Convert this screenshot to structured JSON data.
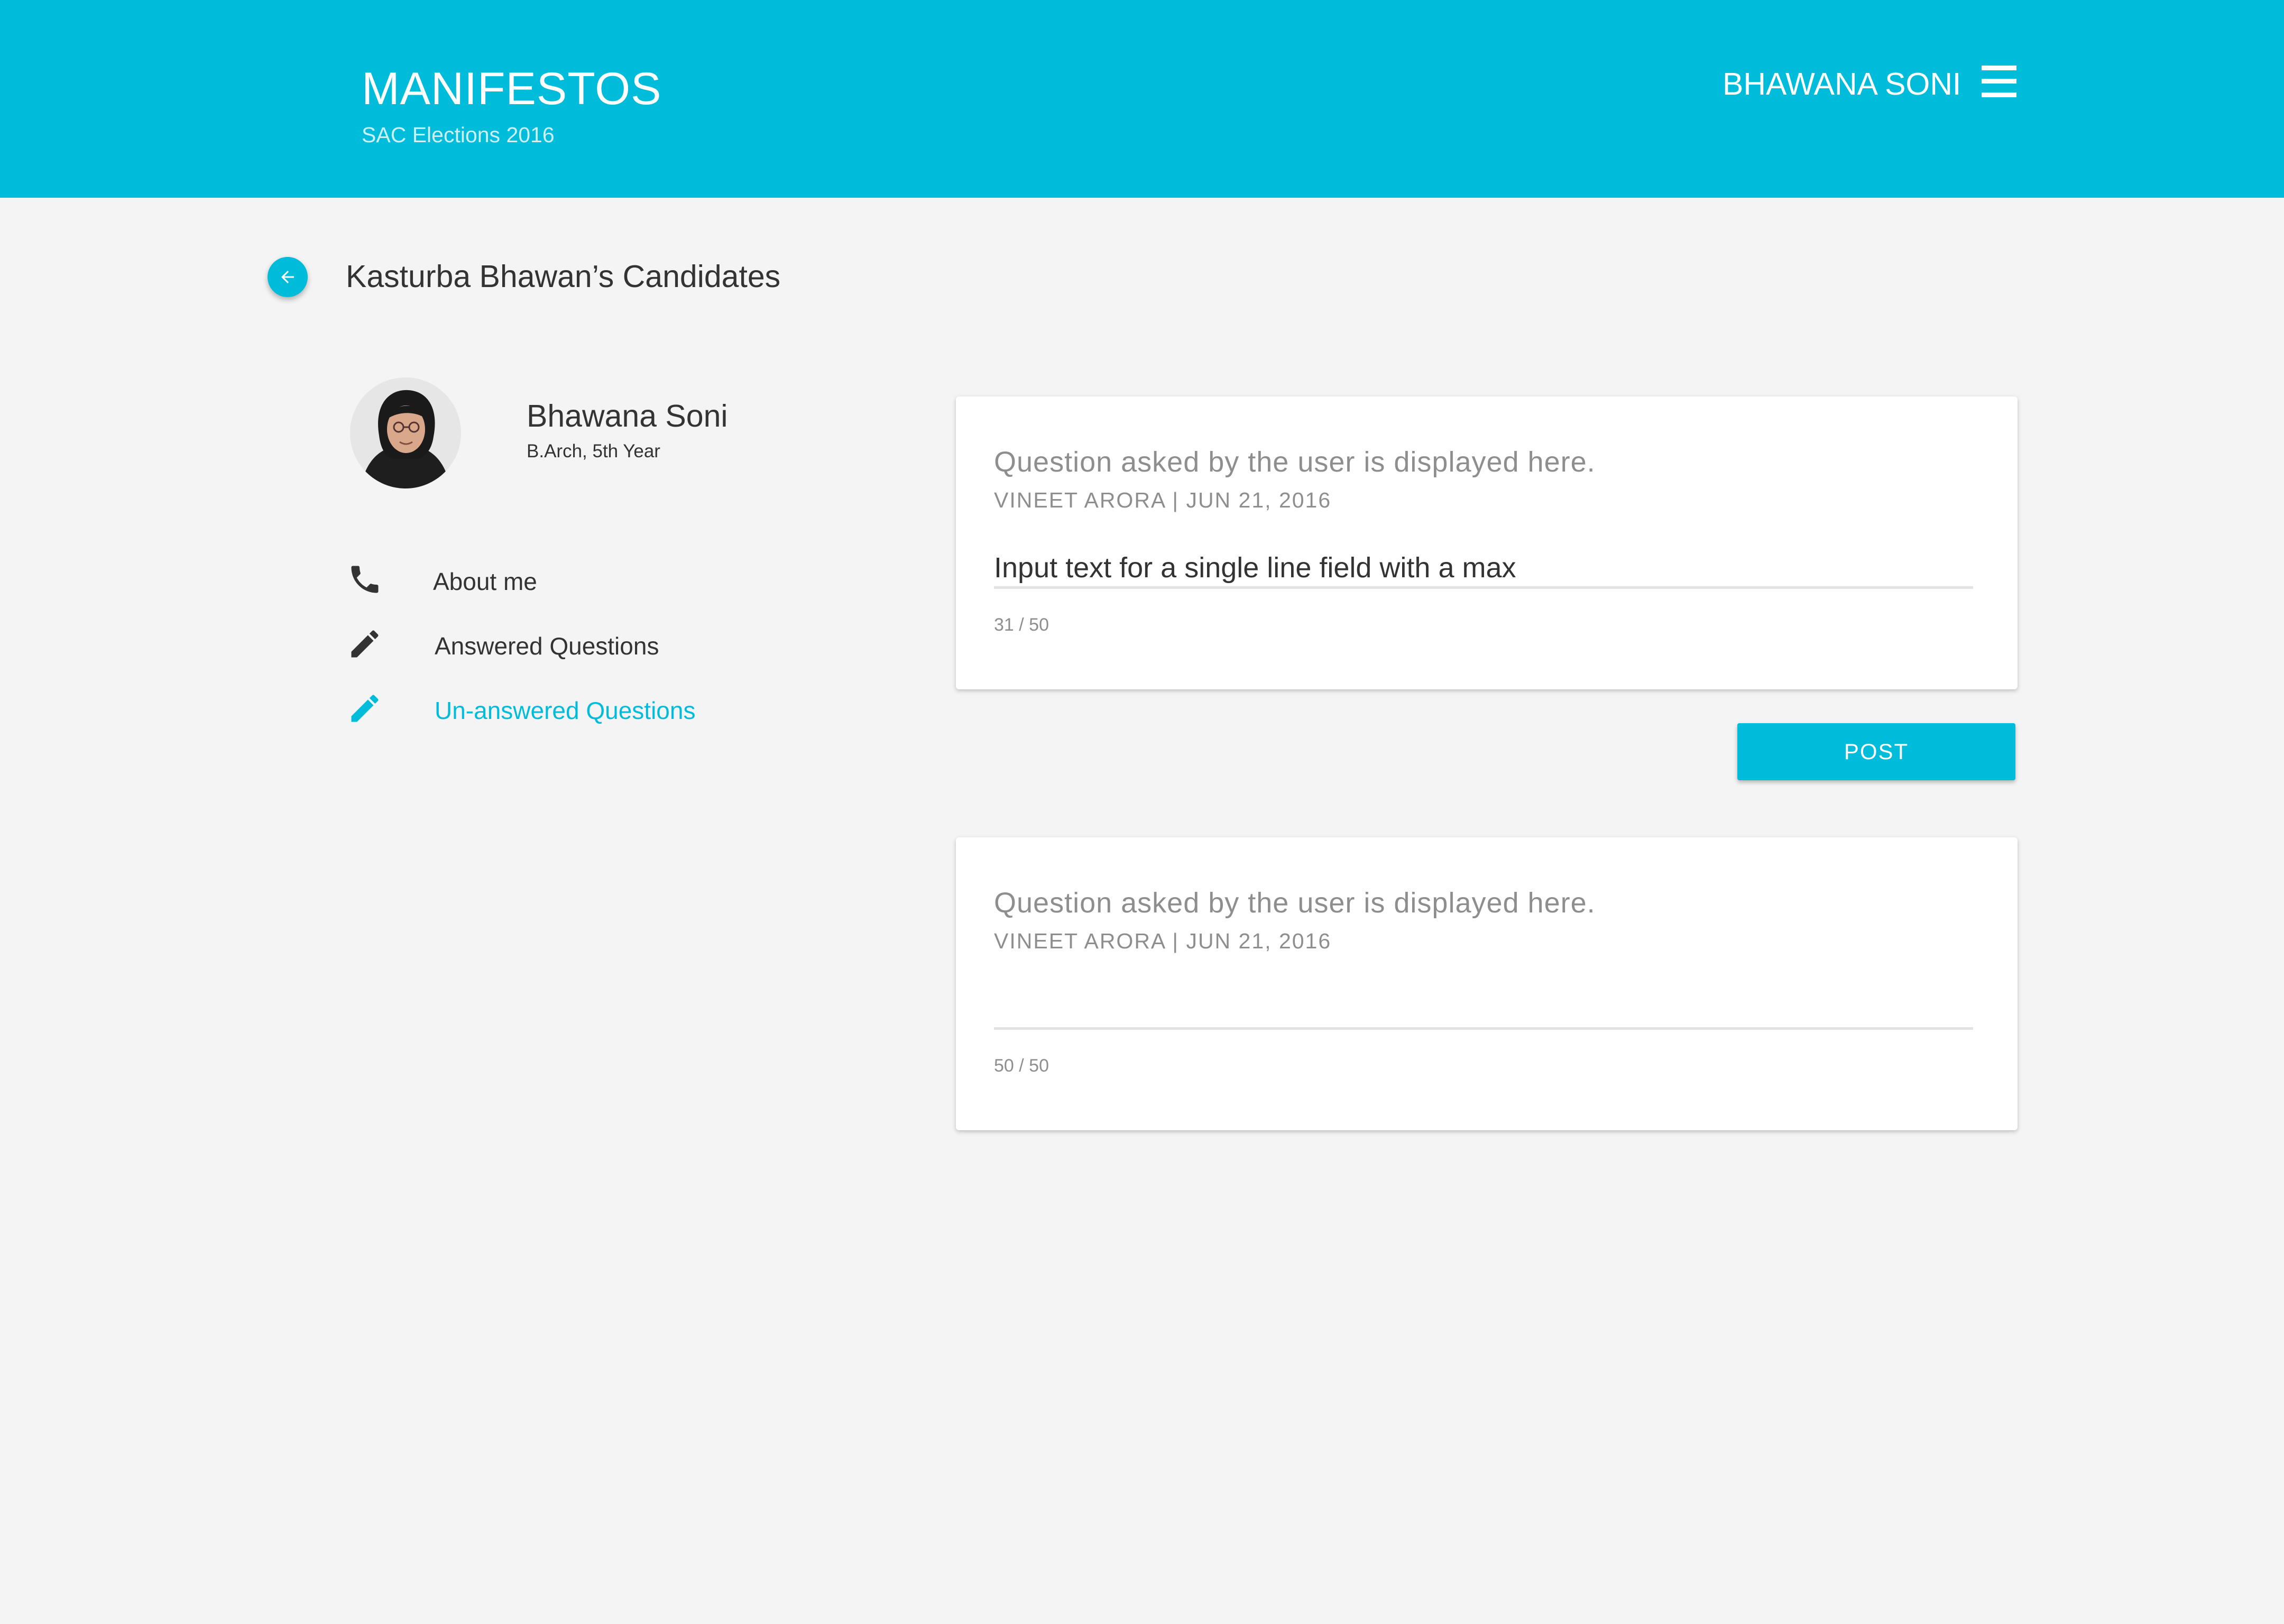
{
  "colors": {
    "accent": "#00bcdb",
    "background": "#f4f4f4",
    "card": "#ffffff",
    "text_primary": "#333333",
    "text_secondary": "#8e8e8e"
  },
  "header": {
    "title": "MANIFESTOS",
    "subtitle": "SAC Elections 2016",
    "user_name": "BHAWANA SONI",
    "menu_icon": "hamburger-menu-icon"
  },
  "page": {
    "back_icon": "arrow-left-icon",
    "title": "Kasturba Bhawan’s Candidates"
  },
  "candidate": {
    "name": "Bhawana Soni",
    "program": "B.Arch, 5th Year"
  },
  "nav": {
    "items": [
      {
        "label": "About me",
        "icon": "phone-icon",
        "active": false
      },
      {
        "label": "Answered Questions",
        "icon": "pencil-icon",
        "active": false
      },
      {
        "label": "Un-answered Questions",
        "icon": "pencil-icon",
        "active": true
      }
    ]
  },
  "questions": [
    {
      "text": "Question asked by the user is displayed here.",
      "meta": "VINEET ARORA | JUN 21, 2016",
      "answer_value": "Input text for a single line field with a max",
      "char_count": "31 / 50"
    },
    {
      "text": "Question asked by the user is displayed here.",
      "meta": "VINEET ARORA | JUN 21, 2016",
      "answer_value": "",
      "char_count": "50 / 50"
    }
  ],
  "post_button": {
    "label": "POST"
  }
}
